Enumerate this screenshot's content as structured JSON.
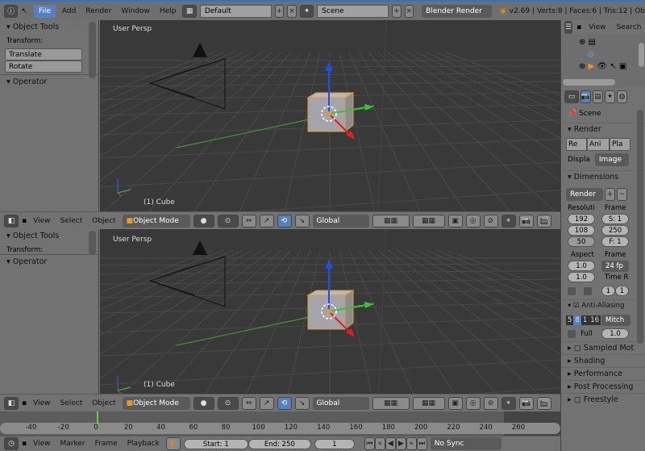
{
  "top_bar": {
    "menus": [
      "File",
      "Add",
      "Render",
      "Window",
      "Help"
    ],
    "screen_layout": "Default",
    "scene": "Scene",
    "render_engine": "Blender Render",
    "stats": "v2.69 | Verts:8 | Faces:6 | Tris:12 | Ob"
  },
  "tool_shelf": [
    {
      "title": "Object Tools",
      "section": "Transform:",
      "buttons": [
        "Translate",
        "Rotate"
      ],
      "operator": "Operator"
    },
    {
      "title": "Object Tools",
      "section": "Transform:",
      "buttons": [],
      "operator": "Operator"
    }
  ],
  "viewports": [
    {
      "label": "User Persp",
      "object": "(1) Cube"
    },
    {
      "label": "User Persp",
      "object": "(1) Cube"
    }
  ],
  "view3d_header": {
    "menus": [
      "View",
      "Select",
      "Object"
    ],
    "mode": "Object Mode",
    "orientation": "Global"
  },
  "timeline": {
    "ticks": [
      -40,
      -20,
      0,
      20,
      40,
      60,
      80,
      100,
      120,
      140,
      160,
      180,
      200,
      220,
      240,
      260
    ],
    "current_frame": 1,
    "start": 1,
    "end": 250
  },
  "timeline_header": {
    "menus": [
      "View",
      "Marker",
      "Frame",
      "Playback"
    ],
    "start_label": "Start: 1",
    "end_label": "End: 250",
    "frame": "1",
    "sync": "No Sync"
  },
  "outliner": {
    "menus": [
      "View",
      "Search"
    ]
  },
  "properties": {
    "context": "Scene",
    "render": {
      "title": "Render",
      "buttons": [
        "Re",
        "Ani",
        "Pla"
      ],
      "display_label": "Displa",
      "display_value": "Image"
    },
    "dimensions": {
      "title": "Dimensions",
      "preset": "Render",
      "resolution_label": "Resoluti",
      "res_x": "192",
      "res_y": "108",
      "res_pct": "50",
      "frame_label": "Frame",
      "start": "S: 1",
      "end": "250",
      "step": "F: 1",
      "aspect_label": "Aspect",
      "aspect_x": "1.0",
      "aspect_y": "1.0",
      "fps": "24 fp",
      "time_remap_label": "Time R",
      "time_old": "1",
      "time_new": "1"
    },
    "anti_aliasing": {
      "title": "Anti-Aliasing",
      "samples": [
        "5",
        "8",
        "1",
        "16"
      ],
      "selected_sample": "8",
      "filter": "Mitch",
      "full_label": "Full",
      "size": "1.0"
    },
    "collapsed_sections": [
      "Sampled Mot",
      "Shading",
      "Performance",
      "Post Processing",
      "Freestyle"
    ]
  }
}
